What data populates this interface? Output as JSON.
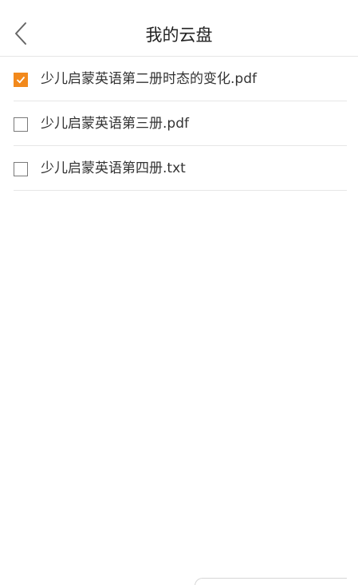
{
  "header": {
    "title": "我的云盘",
    "back_icon": "chevron-left-icon"
  },
  "files": [
    {
      "name": "少儿启蒙英语第二册时态的变化.pdf",
      "checked": true
    },
    {
      "name": "少儿启蒙英语第三册.pdf",
      "checked": false
    },
    {
      "name": "少儿启蒙英语第四册.txt",
      "checked": false
    }
  ],
  "colors": {
    "accent": "#f2891c",
    "divider": "#e6e6e6",
    "text": "#333333"
  }
}
